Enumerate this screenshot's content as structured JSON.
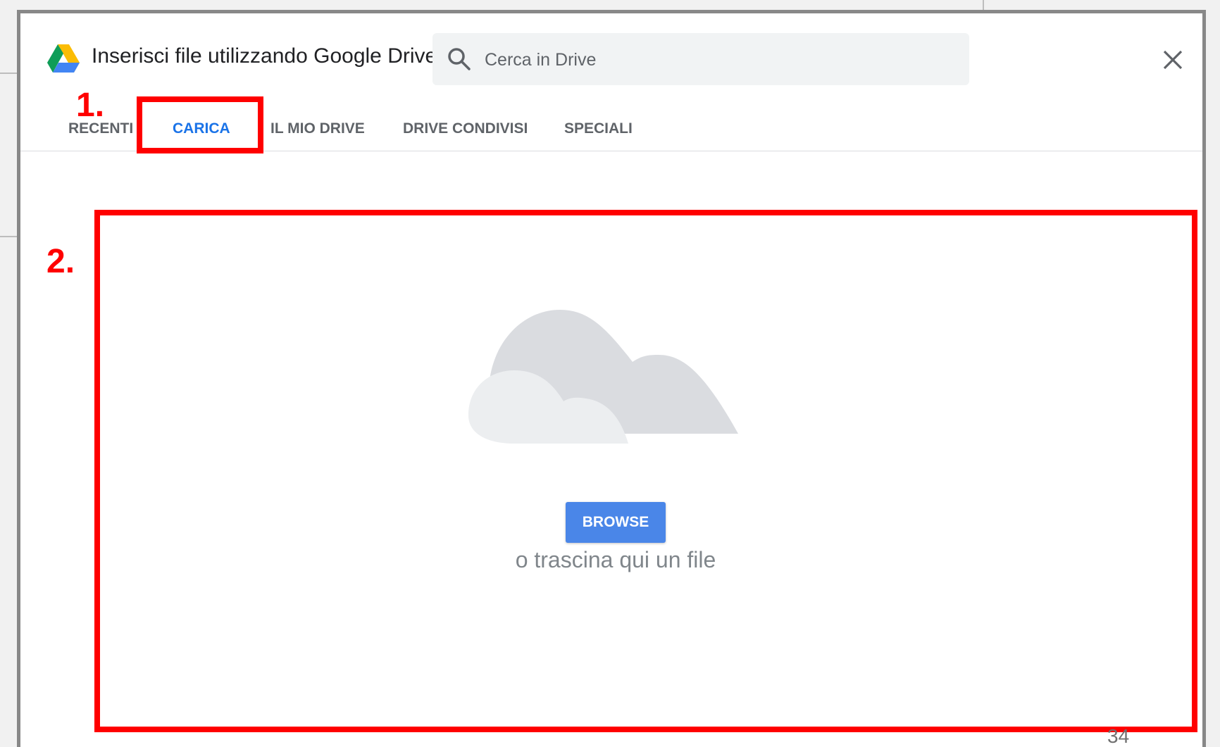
{
  "dialog": {
    "title": "Inserisci file utilizzando Google Drive",
    "logo_icon": "google-drive-logo",
    "close_icon": "close-icon"
  },
  "search": {
    "placeholder": "Cerca in Drive",
    "value": "",
    "icon": "search-icon"
  },
  "tabs": [
    {
      "label": "RECENTI",
      "active": false
    },
    {
      "label": "CARICA",
      "active": true
    },
    {
      "label": "IL MIO DRIVE",
      "active": false
    },
    {
      "label": "DRIVE CONDIVISI",
      "active": false
    },
    {
      "label": "SPECIALI",
      "active": false
    }
  ],
  "upload": {
    "illustration_icon": "cloud-upload-illustration",
    "browse_label": "BROWSE",
    "drop_hint": "o trascina qui un file"
  },
  "annotations": {
    "step1": "1.",
    "step2": "2.",
    "color": "#ff0000"
  },
  "footer": {
    "page_number": "34"
  },
  "colors": {
    "accent": "#1a73e8",
    "browse_button": "#4a86e8",
    "search_bg": "#f1f3f4"
  }
}
